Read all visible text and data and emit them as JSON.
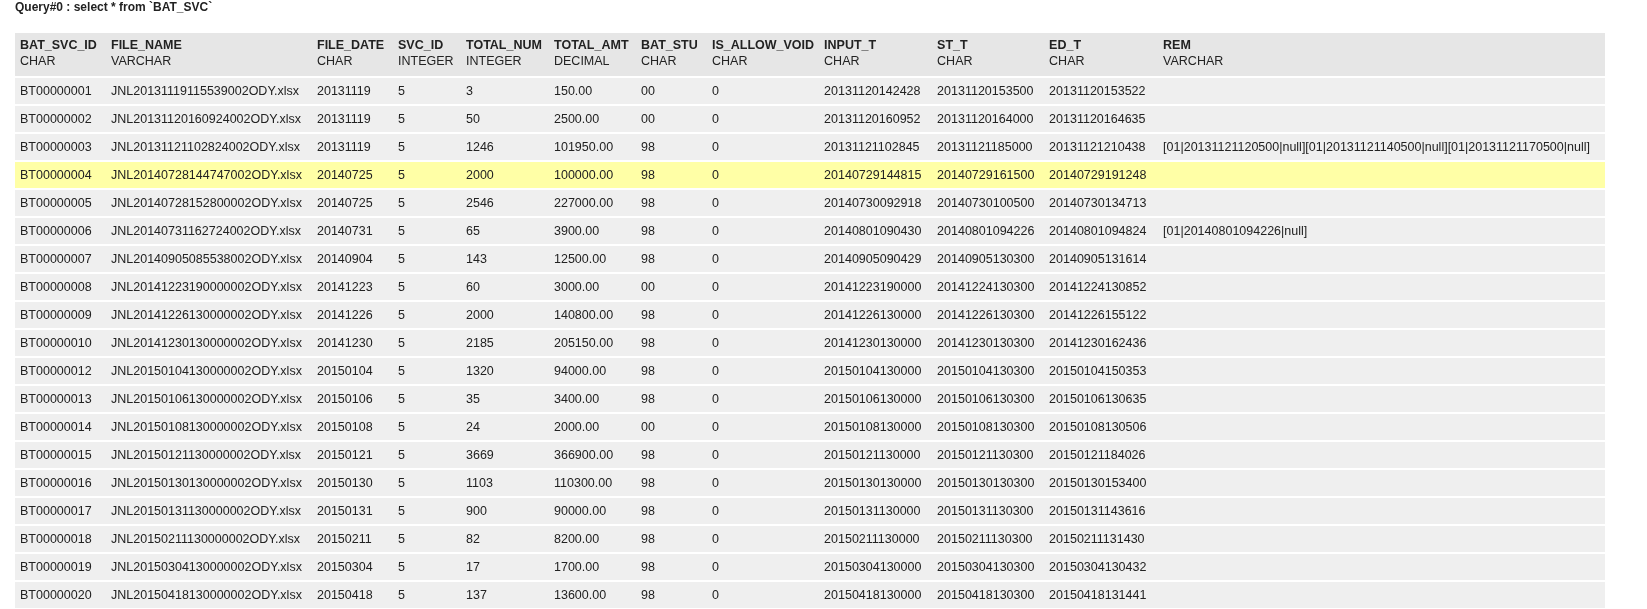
{
  "query_title": "Query#0 : select * from `BAT_SVC`",
  "columns": [
    {
      "name": "BAT_SVC_ID",
      "type": "CHAR"
    },
    {
      "name": "FILE_NAME",
      "type": "VARCHAR"
    },
    {
      "name": "FILE_DATE",
      "type": "CHAR"
    },
    {
      "name": "SVC_ID",
      "type": "INTEGER"
    },
    {
      "name": "TOTAL_NUM",
      "type": "INTEGER"
    },
    {
      "name": "TOTAL_AMT",
      "type": "DECIMAL"
    },
    {
      "name": "BAT_STU",
      "type": "CHAR"
    },
    {
      "name": "IS_ALLOW_VOID",
      "type": "CHAR"
    },
    {
      "name": "INPUT_T",
      "type": "CHAR"
    },
    {
      "name": "ST_T",
      "type": "CHAR"
    },
    {
      "name": "ED_T",
      "type": "CHAR"
    },
    {
      "name": "REM",
      "type": "VARCHAR"
    }
  ],
  "rows": [
    {
      "selected": false,
      "cells": [
        "BT00000001",
        "JNL20131119115539002ODY.xlsx",
        "20131119",
        "5",
        "3",
        "150.00",
        "00",
        "0",
        "20131120142428",
        "20131120153500",
        "20131120153522"
      ]
    },
    {
      "selected": false,
      "cells": [
        "BT00000002",
        "JNL20131120160924002ODY.xlsx",
        "20131119",
        "5",
        "50",
        "2500.00",
        "00",
        "0",
        "20131120160952",
        "20131120164000",
        "20131120164635"
      ]
    },
    {
      "selected": false,
      "cells": [
        "BT00000003",
        "JNL20131121102824002ODY.xlsx",
        "20131119",
        "5",
        "1246",
        "101950.00",
        "98",
        "0",
        "20131121102845",
        "20131121185000",
        "20131121210438",
        "[01|20131121120500|null][01|20131121140500|null][01|20131121170500|null]"
      ]
    },
    {
      "selected": true,
      "cells": [
        "BT00000004",
        "JNL20140728144747002ODY.xlsx",
        "20140725",
        "5",
        "2000",
        "100000.00",
        "98",
        "0",
        "20140729144815",
        "20140729161500",
        "20140729191248"
      ]
    },
    {
      "selected": false,
      "cells": [
        "BT00000005",
        "JNL20140728152800002ODY.xlsx",
        "20140725",
        "5",
        "2546",
        "227000.00",
        "98",
        "0",
        "20140730092918",
        "20140730100500",
        "20140730134713"
      ]
    },
    {
      "selected": false,
      "cells": [
        "BT00000006",
        "JNL20140731162724002ODY.xlsx",
        "20140731",
        "5",
        "65",
        "3900.00",
        "98",
        "0",
        "20140801090430",
        "20140801094226",
        "20140801094824",
        "[01|20140801094226|null]"
      ]
    },
    {
      "selected": false,
      "cells": [
        "BT00000007",
        "JNL20140905085538002ODY.xlsx",
        "20140904",
        "5",
        "143",
        "12500.00",
        "98",
        "0",
        "20140905090429",
        "20140905130300",
        "20140905131614"
      ]
    },
    {
      "selected": false,
      "cells": [
        "BT00000008",
        "JNL20141223190000002ODY.xlsx",
        "20141223",
        "5",
        "60",
        "3000.00",
        "00",
        "0",
        "20141223190000",
        "20141224130300",
        "20141224130852"
      ]
    },
    {
      "selected": false,
      "cells": [
        "BT00000009",
        "JNL20141226130000002ODY.xlsx",
        "20141226",
        "5",
        "2000",
        "140800.00",
        "98",
        "0",
        "20141226130000",
        "20141226130300",
        "20141226155122"
      ]
    },
    {
      "selected": false,
      "cells": [
        "BT00000010",
        "JNL20141230130000002ODY.xlsx",
        "20141230",
        "5",
        "2185",
        "205150.00",
        "98",
        "0",
        "20141230130000",
        "20141230130300",
        "20141230162436"
      ]
    },
    {
      "selected": false,
      "cells": [
        "BT00000012",
        "JNL20150104130000002ODY.xlsx",
        "20150104",
        "5",
        "1320",
        "94000.00",
        "98",
        "0",
        "20150104130000",
        "20150104130300",
        "20150104150353"
      ]
    },
    {
      "selected": false,
      "cells": [
        "BT00000013",
        "JNL20150106130000002ODY.xlsx",
        "20150106",
        "5",
        "35",
        "3400.00",
        "98",
        "0",
        "20150106130000",
        "20150106130300",
        "20150106130635"
      ]
    },
    {
      "selected": false,
      "cells": [
        "BT00000014",
        "JNL20150108130000002ODY.xlsx",
        "20150108",
        "5",
        "24",
        "2000.00",
        "00",
        "0",
        "20150108130000",
        "20150108130300",
        "20150108130506"
      ]
    },
    {
      "selected": false,
      "cells": [
        "BT00000015",
        "JNL20150121130000002ODY.xlsx",
        "20150121",
        "5",
        "3669",
        "366900.00",
        "98",
        "0",
        "20150121130000",
        "20150121130300",
        "20150121184026"
      ]
    },
    {
      "selected": false,
      "cells": [
        "BT00000016",
        "JNL20150130130000002ODY.xlsx",
        "20150130",
        "5",
        "1103",
        "110300.00",
        "98",
        "0",
        "20150130130000",
        "20150130130300",
        "20150130153400"
      ]
    },
    {
      "selected": false,
      "cells": [
        "BT00000017",
        "JNL20150131130000002ODY.xlsx",
        "20150131",
        "5",
        "900",
        "90000.00",
        "98",
        "0",
        "20150131130000",
        "20150131130300",
        "20150131143616"
      ]
    },
    {
      "selected": false,
      "cells": [
        "BT00000018",
        "JNL20150211130000002ODY.xlsx",
        "20150211",
        "5",
        "82",
        "8200.00",
        "98",
        "0",
        "20150211130000",
        "20150211130300",
        "20150211131430"
      ]
    },
    {
      "selected": false,
      "cells": [
        "BT00000019",
        "JNL20150304130000002ODY.xlsx",
        "20150304",
        "5",
        "17",
        "1700.00",
        "98",
        "0",
        "20150304130000",
        "20150304130300",
        "20150304130432"
      ]
    },
    {
      "selected": false,
      "cells": [
        "BT00000020",
        "JNL20150418130000002ODY.xlsx",
        "20150418",
        "5",
        "137",
        "13600.00",
        "98",
        "0",
        "20150418130000",
        "20150418130300",
        "20150418131441"
      ]
    }
  ]
}
